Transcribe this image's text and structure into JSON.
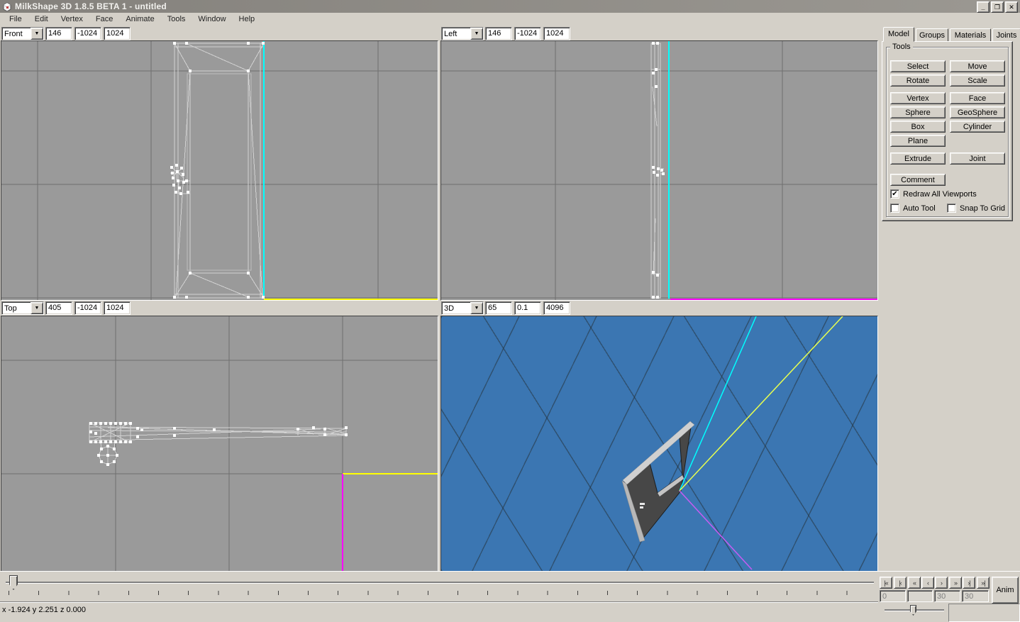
{
  "window": {
    "title": "MilkShape 3D 1.8.5 BETA 1 - untitled",
    "minimize_glyph": "_",
    "restore_glyph": "❐",
    "close_glyph": "✕"
  },
  "menu": {
    "items": [
      "File",
      "Edit",
      "Vertex",
      "Face",
      "Animate",
      "Tools",
      "Window",
      "Help"
    ]
  },
  "viewports": {
    "front": {
      "mode": "Front",
      "fields": [
        "146",
        "-1024",
        "1024"
      ]
    },
    "left": {
      "mode": "Left",
      "fields": [
        "146",
        "-1024",
        "1024"
      ]
    },
    "top": {
      "mode": "Top",
      "fields": [
        "405",
        "-1024",
        "1024"
      ]
    },
    "persp": {
      "mode": "3D",
      "fields": [
        "65",
        "0.1",
        "4096"
      ]
    }
  },
  "panel": {
    "tabs": [
      "Model",
      "Groups",
      "Materials",
      "Joints"
    ],
    "active_tab": "Model",
    "group_title": "Tools",
    "tool_buttons": [
      "Select",
      "Move",
      "Rotate",
      "Scale",
      "Vertex",
      "Face",
      "Sphere",
      "GeoSphere",
      "Box",
      "Cylinder",
      "Plane",
      "Extrude",
      "Joint",
      "Comment"
    ],
    "checkboxes": [
      {
        "label": "Redraw All Viewports",
        "mark": "✔"
      },
      {
        "label": "Auto Tool",
        "mark": ""
      },
      {
        "label": "Snap To Grid",
        "mark": ""
      }
    ]
  },
  "timeline": {
    "playback": [
      "|«",
      "|‹",
      "«",
      "‹",
      "›",
      "»",
      "›|",
      "»|"
    ],
    "frame_fields": [
      "0",
      "",
      "30",
      "30"
    ],
    "anim_label": "Anim"
  },
  "status": {
    "coords": "x -1.924 y 2.251 z 0.000"
  },
  "colors": {
    "axis_x_yellow": "#ffff00",
    "axis_y_cyan": "#00ffff",
    "axis_z_magenta": "#ff00ff",
    "ortho_bg": "#9a9a9a",
    "grid_line": "#6f6f6f",
    "persp_bg": "#3b76b2",
    "chrome_face": "#d4d0c8",
    "wireframe": "#d2d2d2"
  }
}
